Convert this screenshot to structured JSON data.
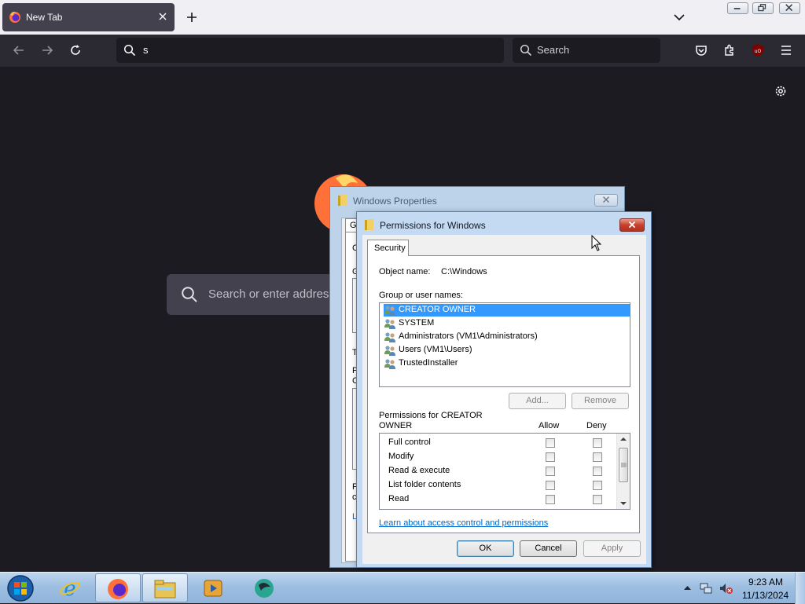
{
  "browser": {
    "tab": {
      "title": "New Tab",
      "icon": "firefox-icon"
    },
    "toolbar": {
      "url_text": "s",
      "search_placeholder": "Search",
      "icons": [
        "back-icon",
        "forward-icon",
        "reload-icon",
        "pocket-icon",
        "extensions-icon",
        "ublock-icon",
        "menu-icon"
      ]
    },
    "newtab": {
      "search_placeholder": "Search or enter address",
      "settings_icon": "gear-icon"
    }
  },
  "props_window": {
    "title": "Windows Properties",
    "partial_tab": "Ge",
    "partial_letters": [
      "C",
      "G",
      "T",
      "F",
      "C",
      "F",
      "c",
      "L"
    ]
  },
  "perm_dialog": {
    "title": "Permissions for Windows",
    "tab": "Security",
    "object_name_label": "Object name:",
    "object_name_value": "C:\\Windows",
    "group_label": "Group or user names:",
    "users": [
      {
        "name": "CREATOR OWNER",
        "selected": true
      },
      {
        "name": "SYSTEM",
        "selected": false
      },
      {
        "name": "Administrators (VM1\\Administrators)",
        "selected": false
      },
      {
        "name": "Users (VM1\\Users)",
        "selected": false
      },
      {
        "name": "TrustedInstaller",
        "selected": false
      }
    ],
    "add_button": "Add...",
    "remove_button": "Remove",
    "perm_label_line1": "Permissions for CREATOR",
    "perm_label_line2": "OWNER",
    "allow_header": "Allow",
    "deny_header": "Deny",
    "permissions": [
      {
        "name": "Full control",
        "allow": false,
        "deny": false
      },
      {
        "name": "Modify",
        "allow": false,
        "deny": false
      },
      {
        "name": "Read & execute",
        "allow": false,
        "deny": false
      },
      {
        "name": "List folder contents",
        "allow": false,
        "deny": false
      },
      {
        "name": "Read",
        "allow": false,
        "deny": false
      }
    ],
    "learn_link": "Learn about access control and permissions",
    "ok_button": "OK",
    "cancel_button": "Cancel",
    "apply_button": "Apply"
  },
  "taskbar": {
    "apps": [
      "internet-explorer-icon",
      "firefox-icon",
      "file-explorer-icon",
      "media-player-icon",
      "app-icon"
    ],
    "time": "9:23 AM",
    "date": "11/13/2024"
  },
  "colors": {
    "firefox_bg": "#1c1b22",
    "toolbar_bg": "#2b2a33",
    "selection": "#3399ff",
    "link": "#0066cc"
  }
}
